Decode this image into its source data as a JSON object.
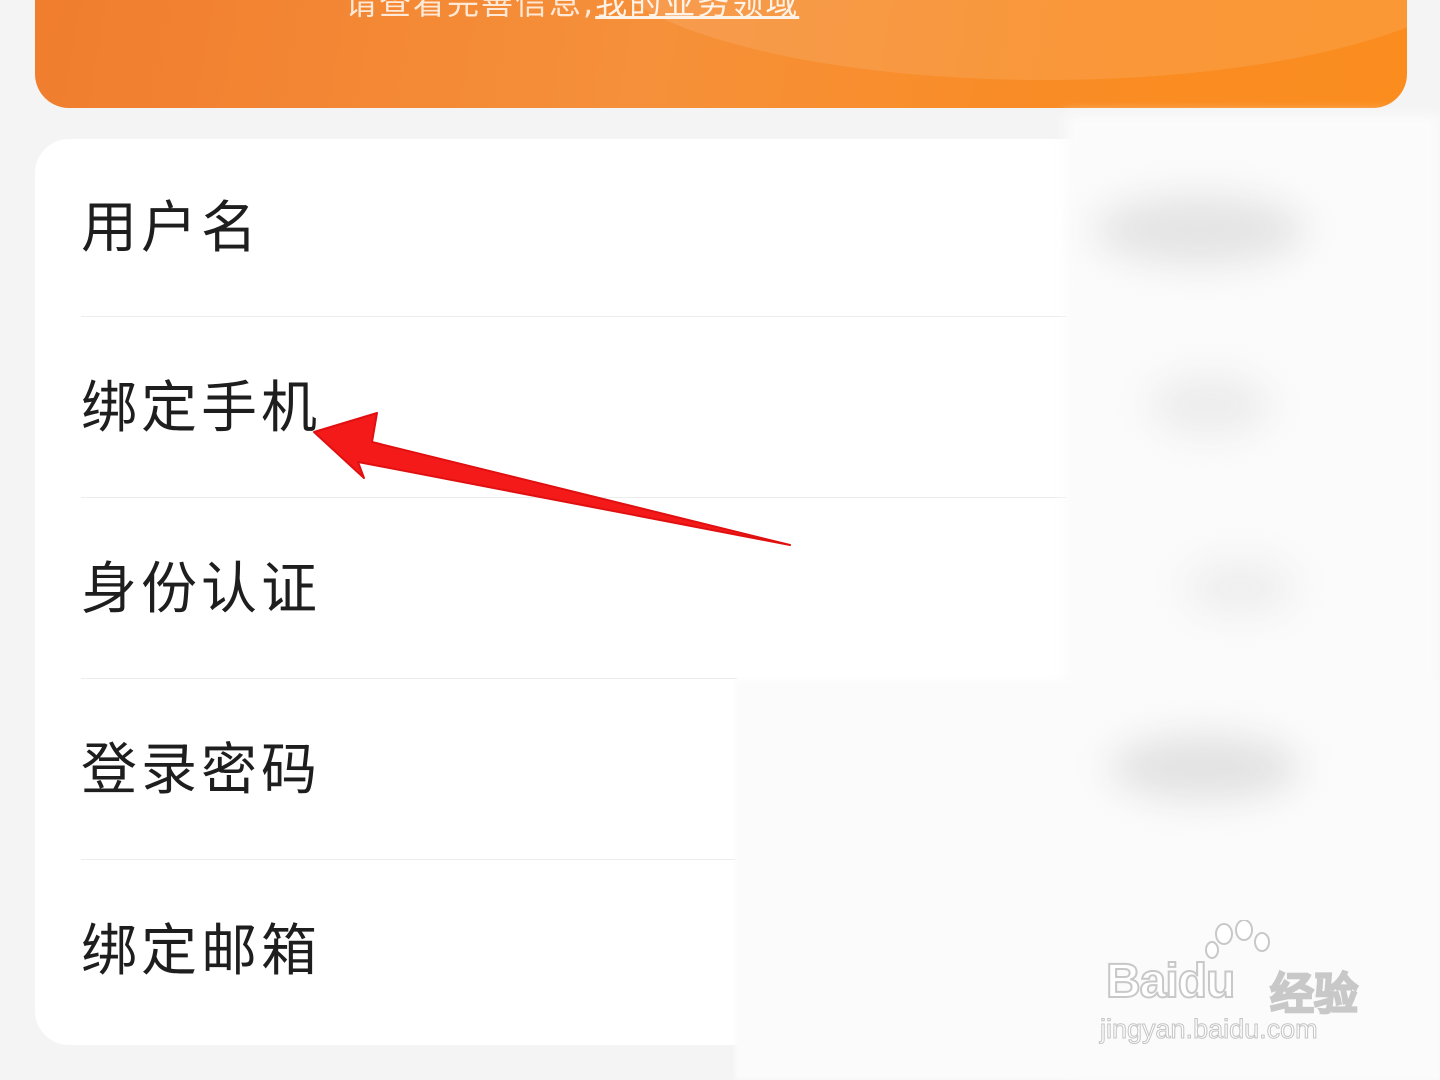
{
  "banner": {
    "text": "请查看完善信息",
    "link": "我的业务领域"
  },
  "settings": {
    "items": [
      {
        "label": "用户名"
      },
      {
        "label": "绑定手机"
      },
      {
        "label": "身份认证"
      },
      {
        "label": "登录密码"
      },
      {
        "label": "绑定邮箱"
      }
    ]
  },
  "watermark": {
    "logo": "Baidu",
    "product": "经验",
    "url": "jingyan.baidu.com"
  },
  "colors": {
    "banner_start": "#f07d2e",
    "banner_end": "#fb8d1f",
    "arrow": "#f51a1a",
    "card": "#ffffff",
    "background": "#f4f4f4"
  }
}
